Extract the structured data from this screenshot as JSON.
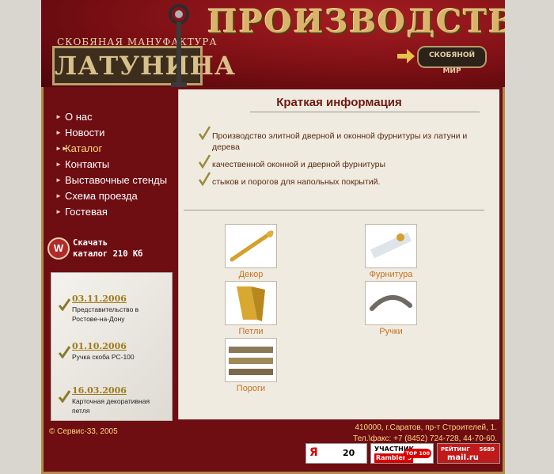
{
  "header": {
    "title": "ПРОИЗВОДСТВО",
    "brand_small": "СКОБЯНАЯ МАНУФАКТУРА",
    "brand_big": "ЛАТУНИНА",
    "badge": "СКОБЯНОЙ МИР"
  },
  "nav": {
    "items": [
      {
        "label": "О нас"
      },
      {
        "label": "Новости"
      },
      {
        "label": "Каталог"
      },
      {
        "label": "Контакты"
      },
      {
        "label": "Выставочные стенды"
      },
      {
        "label": "Схема проезда"
      },
      {
        "label": "Гостевая"
      }
    ],
    "active_index": 2
  },
  "download": {
    "line1": "Скачать",
    "line2": "каталог 210 Кб"
  },
  "news": [
    {
      "date": "03.11.2006",
      "text": "Представительство в Ростове-на-Дону"
    },
    {
      "date": "01.10.2006",
      "text": "Ручка скоба РС-100"
    },
    {
      "date": "16.03.2006",
      "text": "Карточная декоративная петля"
    }
  ],
  "content": {
    "heading": "Краткая информация",
    "bullets": [
      "Производство элитной дверной и оконной фурнитуры из латуни и дерева",
      "качественной оконной и дверной фурнитуры",
      "стыков и порогов для напольных покрытий."
    ],
    "categories": [
      {
        "label": "Декор"
      },
      {
        "label": "Фурнитура"
      },
      {
        "label": "Петли"
      },
      {
        "label": "Ручки"
      },
      {
        "label": "Пороги"
      }
    ]
  },
  "footer": {
    "copyright": "© Сервис-33, 2005",
    "address": "410000, г.Саратов, пр-т Строителей, 1.",
    "phone": "Тел.\\факс: +7 (8452) 724-728, 44-70-60."
  },
  "counters": {
    "yandex_num": "20",
    "rambler_line1": "УЧАСТНИК",
    "rambler_line2": "Rambler's",
    "rambler_top": "TOP 100",
    "mail_line1": "РЕЙТИНГ",
    "mail_num": "5689",
    "mail_brand": "mail.ru"
  },
  "colors": {
    "bg_maroon": "#6e0d12",
    "gold": "#d9b36b",
    "link_orange": "#c6721f",
    "active_nav": "#ffd97a"
  }
}
